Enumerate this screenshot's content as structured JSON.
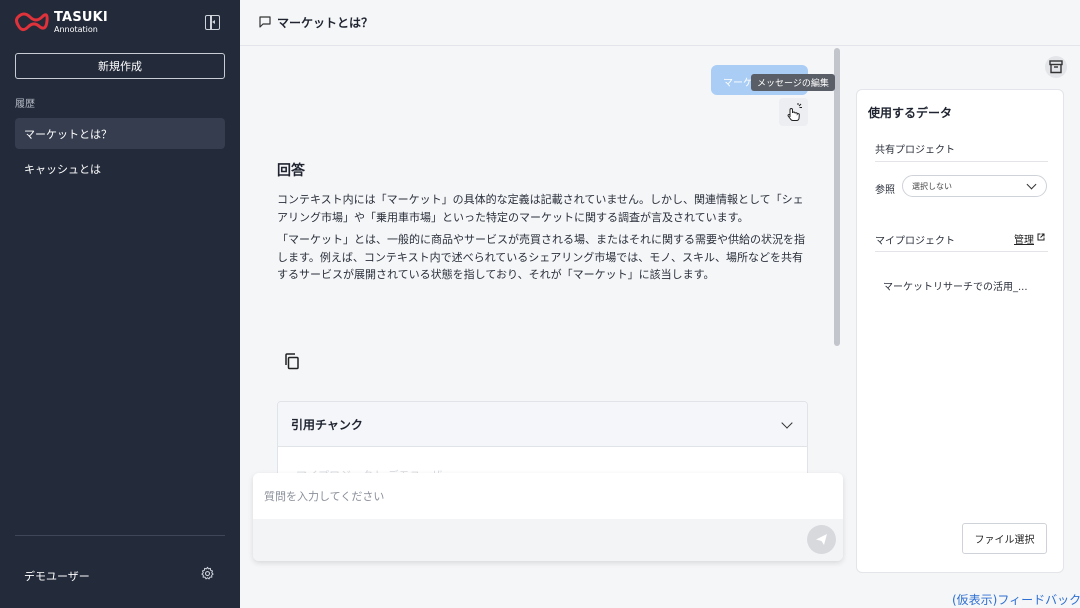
{
  "brand": {
    "title": "TASUKI",
    "subtitle": "Annotation",
    "logo_icon": "tasuki-logo",
    "accent": "#e0323a"
  },
  "sidebar": {
    "new_button": "新規作成",
    "history_label": "履歴",
    "history": [
      {
        "label": "マーケットとは？",
        "active": true
      },
      {
        "label": "キャッシュとは",
        "active": false
      }
    ],
    "user_name": "デモユーザー",
    "bg_color": "#232a3a"
  },
  "header": {
    "title": "マーケットとは？"
  },
  "chat": {
    "user_message": "マーケットとは？",
    "tooltip": "メッセージの編集",
    "answer_title": "回答",
    "answer_paragraphs": [
      "コンテキスト内には「マーケット」の具体的な定義は記載されていません。しかし、関連情報として「シェアリング市場」や「乗用車市場」といった特定のマーケットに関する調査が言及されています。",
      "「マーケット」とは、一般的に商品やサービスが売買される場、またはそれに関する需要や供給の状況を指します。例えば、コンテキスト内で述べられているシェアリング市場では、モノ、スキル、場所などを共有するサービスが展開されている状態を指しており、それが「マーケット」に該当します。"
    ],
    "citation_title": "引用チャンク",
    "citation_faded": "マイプロジェクト デモユーザ"
  },
  "input": {
    "placeholder": "質問を入力してください",
    "value": ""
  },
  "panel": {
    "title": "使用するデータ",
    "shared_project": "共有プロジェクト",
    "reference_label": "参照",
    "reference_value": "選択しない",
    "my_project": "マイプロジェクト",
    "manage_link": "管理",
    "project_item": "マーケットリサーチでの活用_...",
    "file_button": "ファイル選択"
  },
  "feedback": "(仮表示)フィードバック"
}
